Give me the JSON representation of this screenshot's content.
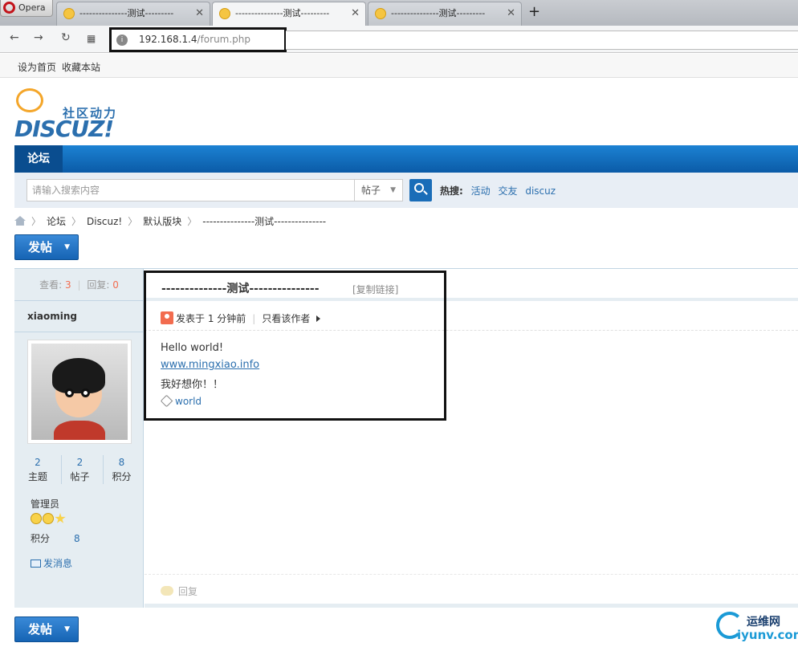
{
  "browser": {
    "menu_label": "Opera",
    "tabs": [
      {
        "label": "---------------测试---------"
      },
      {
        "label": "---------------测试---------"
      },
      {
        "label": "---------------测试---------"
      }
    ],
    "url_host": "192.168.1.4",
    "url_path": "/forum.php"
  },
  "toplinks": {
    "set_home": "设为首页",
    "bookmark": "收藏本站"
  },
  "logo": {
    "slogan": "社区动力",
    "word": "DISCUZ!"
  },
  "nav": {
    "forum": "论坛"
  },
  "search": {
    "placeholder": "请输入搜索内容",
    "type": "帖子",
    "hot_label": "热搜:",
    "hot": [
      "活动",
      "交友",
      "discuz"
    ]
  },
  "breadcrumb": [
    "论坛",
    "Discuz!",
    "默认版块",
    "---------------测试---------------"
  ],
  "post_button": "发帖",
  "thread": {
    "views_label": "查看:",
    "views": "3",
    "replies_label": "回复:",
    "replies": "0",
    "title": "--------------测试---------------",
    "copy_link": "[复制链接]",
    "posted": "发表于 1 分钟前",
    "only_author": "只看该作者",
    "content": [
      "Hello world!",
      "www.mingxiao.info",
      "我好想你！！"
    ],
    "tag": "world",
    "reply": "回复"
  },
  "author": {
    "name": "xiaoming",
    "stats": [
      {
        "value": "2",
        "label": "主题"
      },
      {
        "value": "2",
        "label": "帖子"
      },
      {
        "value": "8",
        "label": "积分"
      }
    ],
    "role": "管理员",
    "points_label": "积分",
    "points": "8",
    "send_message": "发消息"
  },
  "watermark": {
    "cn": "运维网",
    "en": "iyunv.com"
  },
  "colors": {
    "brand": "#1a6db8",
    "link": "#2b6fae",
    "highlight": "#f26c4f",
    "panel": "#e5edf2"
  }
}
